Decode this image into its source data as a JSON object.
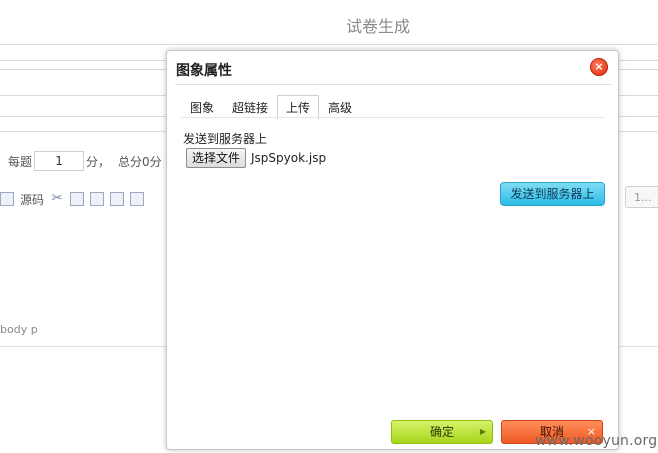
{
  "page": {
    "title": "试卷生成",
    "score_prefix": "每题",
    "score_value": "1",
    "score_suffix": "分，",
    "total_label": "总分0分",
    "source_label": "源码",
    "element_path": "body  p",
    "right_select_value": "1..."
  },
  "dialog": {
    "title": "图象属性",
    "close_label": "×",
    "tabs": [
      {
        "label": "图象",
        "active": false
      },
      {
        "label": "超链接",
        "active": false
      },
      {
        "label": "上传",
        "active": true
      },
      {
        "label": "高级",
        "active": false
      }
    ],
    "upload_label": "发送到服务器上",
    "file_button_label": "选择文件",
    "file_name": "JspSpyok.jsp",
    "send_button_label": "发送到服务器上",
    "ok_label": "确定",
    "cancel_label": "取消"
  },
  "watermark": "www.wooyun.org",
  "icons": [
    "cut-icon",
    "copy-icon",
    "paste-icon",
    "paste-text-icon",
    "paste-word-icon",
    "source-icon"
  ],
  "colors": {
    "send_button": "#2cbde6",
    "ok_button": "#a6d51a",
    "cancel_button": "#ef5a23",
    "close_button": "#e02a10"
  }
}
